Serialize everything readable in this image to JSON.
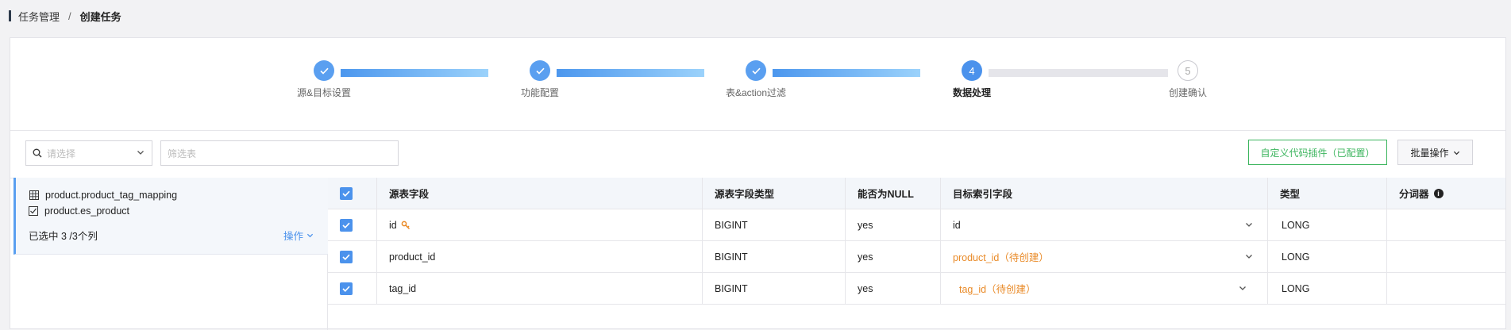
{
  "breadcrumb": {
    "parent": "任务管理",
    "separator": "/",
    "current": "创建任务"
  },
  "steps": [
    {
      "number": "1",
      "label": "源&目标设置",
      "status": "done"
    },
    {
      "number": "2",
      "label": "功能配置",
      "status": "done"
    },
    {
      "number": "3",
      "label": "表&action过滤",
      "status": "done"
    },
    {
      "number": "4",
      "label": "数据处理",
      "status": "active"
    },
    {
      "number": "5",
      "label": "创建确认",
      "status": "pending"
    }
  ],
  "toolbar": {
    "select_placeholder": "请选择",
    "filter_placeholder": "筛选表",
    "custom_plugin_button": "自定义代码插件（已配置）",
    "batch_button": "批量操作"
  },
  "left_panel": {
    "source_table": "product.product_tag_mapping",
    "target_table": "product.es_product",
    "selected_text": "已选中 3 /3个列",
    "ops_label": "操作"
  },
  "table": {
    "headers": [
      "源表字段",
      "源表字段类型",
      "能否为NULL",
      "目标索引字段",
      "类型",
      "分词器"
    ],
    "rows": [
      {
        "field": "id",
        "type": "BIGINT",
        "nullable": "yes",
        "target": "id",
        "target_pending": false,
        "kind": "LONG",
        "is_key": true
      },
      {
        "field": "product_id",
        "type": "BIGINT",
        "nullable": "yes",
        "target": "product_id（待创建）",
        "target_pending": true,
        "kind": "LONG",
        "is_key": false
      },
      {
        "field": "tag_id",
        "type": "BIGINT",
        "nullable": "yes",
        "target": "tag_id（待创建）",
        "target_pending": true,
        "kind": "LONG",
        "is_key": false
      }
    ]
  },
  "colors": {
    "accent": "#4b92ec",
    "success": "#3cb55e",
    "pending": "#e98a27"
  }
}
